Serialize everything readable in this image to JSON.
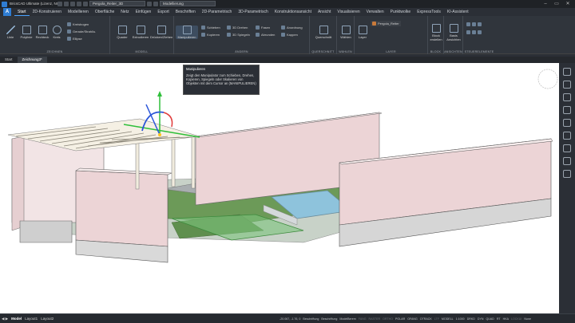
{
  "window": {
    "title": "BricsCAD Ultimate (Lizenz, NICHT ZUM WIEDERVERKAUF) - [Zeichnung3]",
    "drawing_combo": "Pergola_Reiter_3D",
    "workspace_combo": "Modellierung"
  },
  "tabs": [
    "Start",
    "2D-Konstruieren",
    "Modellieren",
    "Oberfläche",
    "Netz",
    "Einfügen",
    "Export",
    "Beschriften",
    "2D-Parametrisch",
    "3D-Parametrisch",
    "Konstruktionsansicht",
    "Ansicht",
    "Visualisieren",
    "Verwalten",
    "Punktwolke",
    "ExpressTools",
    "KI-Assistent"
  ],
  "ribbon": {
    "zeichnen": {
      "label": "ZEICHNEN",
      "buttons": [
        "Linie",
        "Polylinie",
        "Rechteck",
        "Kreis"
      ],
      "small": [
        "Kreisbogen",
        "Ellipse"
      ],
      "small_prefix": "Gerade/Strahl/u."
    },
    "modell": {
      "label": "MODELL",
      "buttons": [
        "Quader",
        "Extrudieren",
        "Drücken/Ziehen"
      ]
    },
    "aendern": {
      "label": "ÄNDERN",
      "big": "Manipulieren",
      "small": [
        "Schieben",
        "Kopieren",
        "3D Drehen",
        "3D Spiegeln",
        "Fasen",
        "Abrunden",
        "Anordnung",
        "Kappen"
      ]
    },
    "querschnitt": {
      "label": "QUERSCHNITT",
      "button": "Querschnitt"
    },
    "waehlen": {
      "label": "WÄHLEN",
      "button": "Wählen"
    },
    "layer": {
      "label": "LAYER",
      "button": "Layer",
      "current": "Pergola_Reiter"
    },
    "block": {
      "label": "BLOCK",
      "button": "Block erstellen"
    },
    "ansichten": {
      "label": "ANSICHTEN",
      "button": "Basis Ansichten"
    },
    "steuerelemente": {
      "label": "STEUERELEMENTE"
    }
  },
  "doc_tabs": [
    "Start",
    "Zeichnung3*"
  ],
  "tooltip": {
    "title": "Manipulieren",
    "body": "Zeigt den Manipulator zum Schieben, Drehen, Kopieren, Spiegeln oder Skalieren von Objekten mit dem Cursor an (MANIPULIEREN)"
  },
  "layout_tabs": [
    "Model",
    "Layout1",
    "Layout2"
  ],
  "status": {
    "coords": "-20.067, -1.76, 0",
    "items": [
      "Beschriftung",
      "Beschriftung",
      "ModelBerem",
      "FANG",
      "RASTER",
      "ORTHO",
      "POLAR",
      "OFANG",
      "OTRACK",
      "LTF",
      "MODELL",
      "1:1000",
      "DRKD",
      "DYN",
      "QUAD",
      "RT",
      "HKA",
      "LOCKUI",
      "None"
    ],
    "off_items": [
      "FANG",
      "RASTER",
      "ORTHO",
      "LTF",
      "LOCKUI"
    ]
  },
  "colors": {
    "accent": "#2f7dd3",
    "wall": "#ecd4d6",
    "ground": "#9aa89a",
    "grass": "#5f8f4e"
  }
}
